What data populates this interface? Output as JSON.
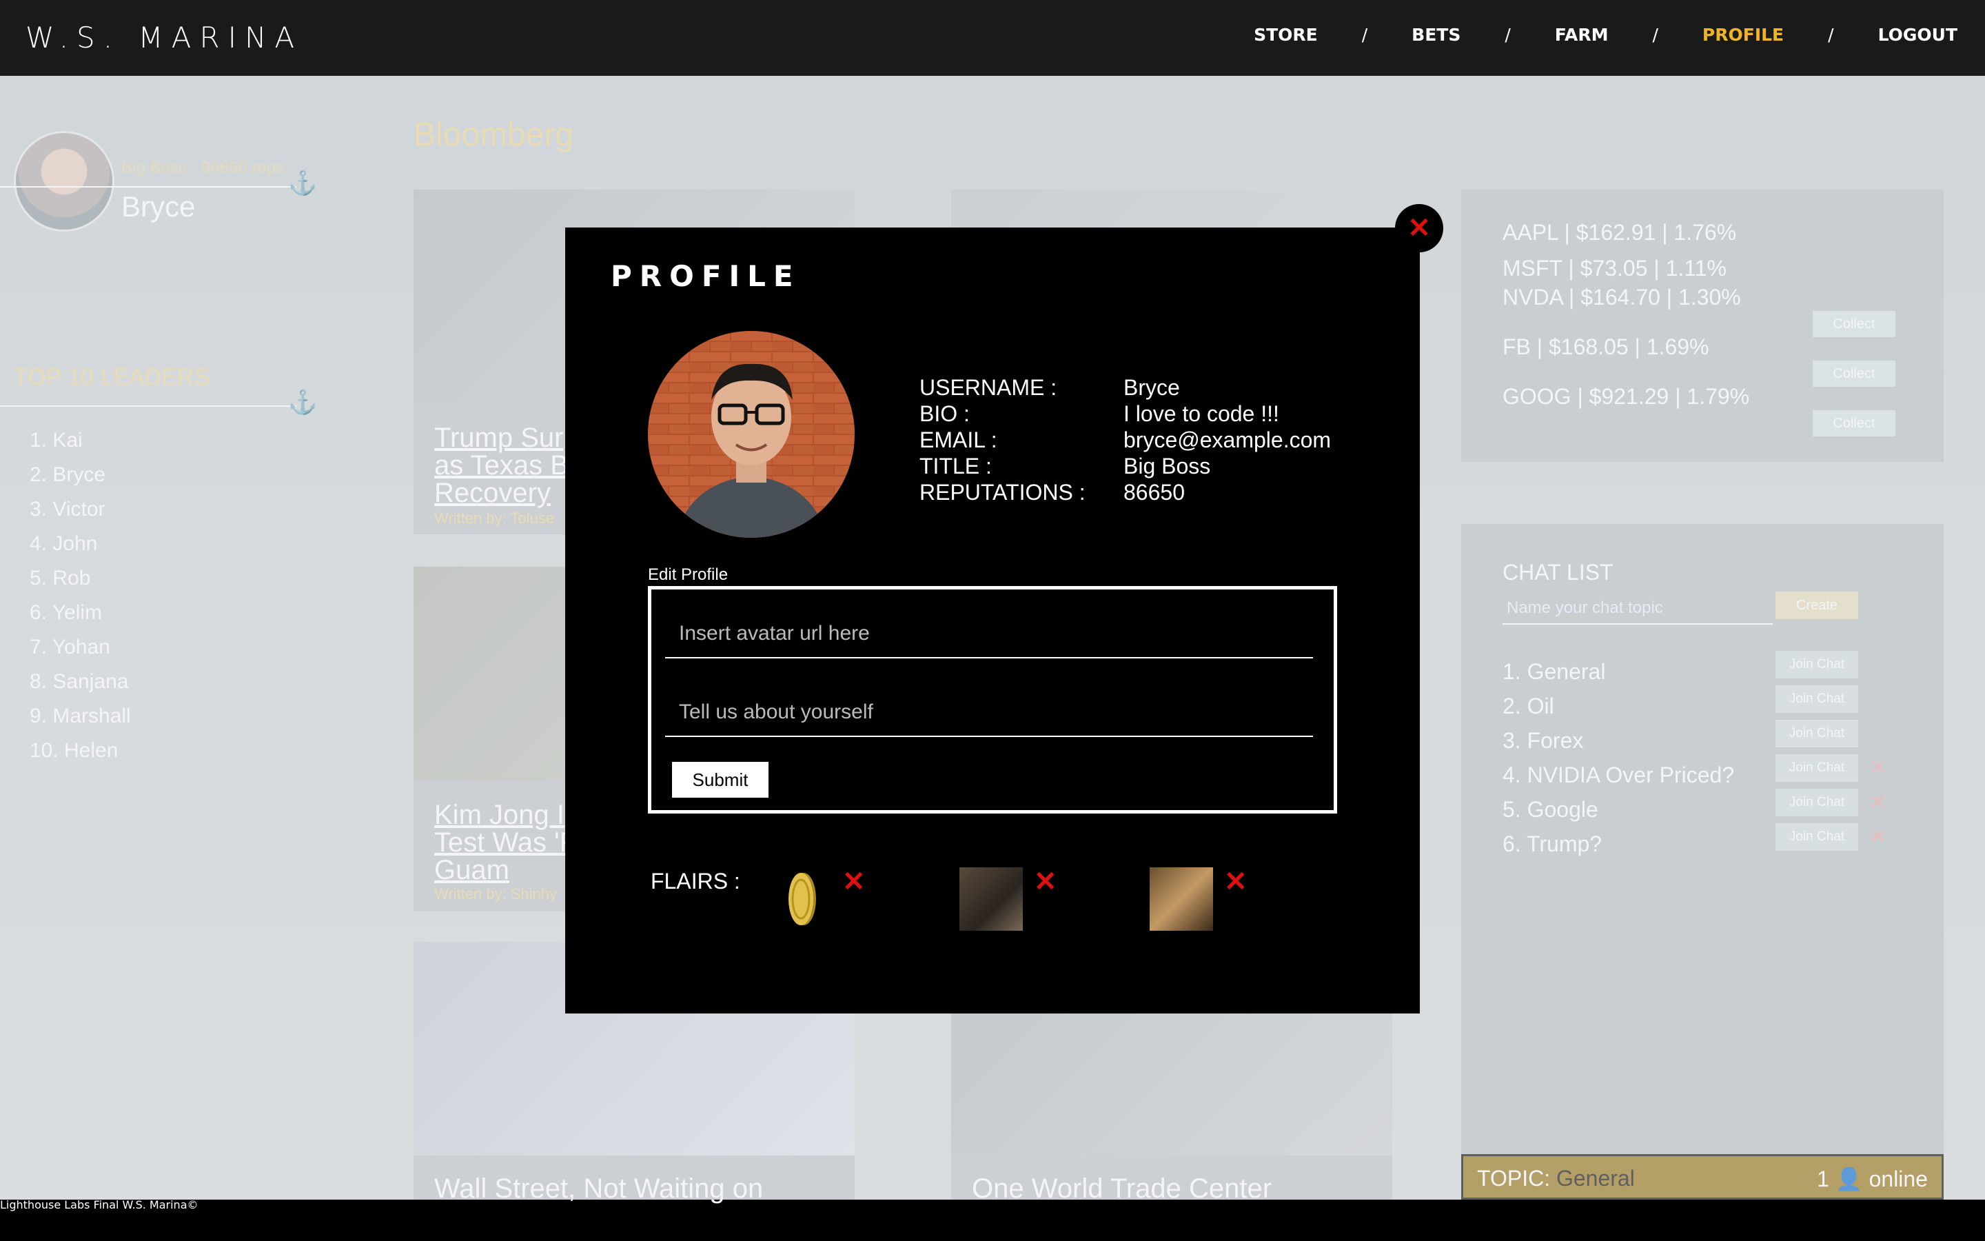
{
  "header": {
    "brand": "W.S. MARINA",
    "nav": [
      {
        "label": "STORE"
      },
      {
        "label": "BETS"
      },
      {
        "label": "FARM"
      },
      {
        "label": "PROFILE"
      },
      {
        "label": "LOGOUT"
      }
    ],
    "separator": "/",
    "active_color": "#f0b429"
  },
  "sidebar": {
    "user_meta": "Big Boss · 86650 reps",
    "user_name": "Bryce",
    "leaders_title": "TOP 10 LEADERS",
    "leaders": [
      "1. Kai",
      "2. Bryce",
      "3. Victor",
      "4. John",
      "5. Rob",
      "6. Yelim",
      "7. Yohan",
      "8. Sanjana",
      "9. Marshall",
      "10. Helen"
    ]
  },
  "main": {
    "section_title": "Bloomberg",
    "cards": [
      {
        "title_lines": [
          "Trump Sur",
          "as Texas B",
          "Recovery"
        ],
        "byline": "Written by: Toluse"
      },
      {
        "title_lines": [],
        "byline": ""
      },
      {
        "title_lines": [
          "Kim Jong I",
          "Test Was 'F",
          "Guam"
        ],
        "byline": "Written by: Shinhy"
      },
      {
        "title_lines": [],
        "byline": ""
      },
      {
        "title_lines": [
          "Wall Street, Not Waiting on"
        ],
        "byline": ""
      },
      {
        "title_lines": [
          "One World Trade Center"
        ],
        "byline": ""
      }
    ]
  },
  "stocks": {
    "items": [
      "AAPL | $162.91 | 1.76%",
      "MSFT | $73.05 | 1.11%",
      "NVDA | $164.70 | 1.30%",
      "FB | $168.05 | 1.69%",
      "GOOG | $921.29 | 1.79%"
    ],
    "collect_label": "Collect"
  },
  "chat": {
    "title": "CHAT LIST",
    "input_placeholder": "Name your chat topic",
    "create_label": "Create",
    "join_label": "Join Chat",
    "items": [
      "1. General",
      "2. Oil",
      "3. Forex",
      "4. NVIDIA Over Priced?",
      "5. Google",
      "6. Trump?"
    ],
    "delete_mark": "✕",
    "topic_prefix": "TOPIC:",
    "topic_value": "General",
    "online_count": "1",
    "online_icon": "user-icon",
    "online_suffix": "online"
  },
  "footer": {
    "text": "Lighthouse Labs Final W.S. Marina©"
  },
  "modal": {
    "title": "PROFILE",
    "close_mark": "✕",
    "info": [
      {
        "label": "USERNAME :",
        "value": "Bryce"
      },
      {
        "label": "BIO :",
        "value": "I love to code !!!"
      },
      {
        "label": "EMAIL :",
        "value": "bryce@example.com"
      },
      {
        "label": "TITLE :",
        "value": "Big Boss"
      },
      {
        "label": "REPUTATIONS :",
        "value": "86650"
      }
    ],
    "edit_label": "Edit Profile",
    "avatar_placeholder": "Insert avatar url here",
    "bio_placeholder": "Tell us about yourself",
    "submit_label": "Submit",
    "flairs_label": "FLAIRS :",
    "flair_remove": "✕",
    "flairs": [
      "coin-flair",
      "photo-flair",
      "photo-flair"
    ],
    "accent_red": "#e01010"
  }
}
